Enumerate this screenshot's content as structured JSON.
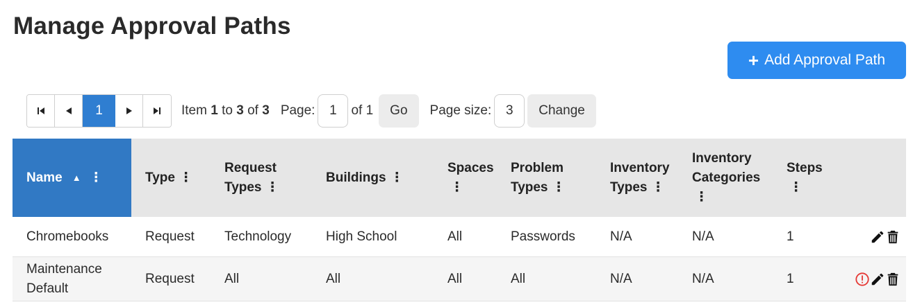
{
  "page": {
    "title": "Manage Approval Paths"
  },
  "add_button": {
    "plus": "+",
    "label": "Add Approval Path"
  },
  "pager": {
    "current_page": "1",
    "item_prefix": "Item",
    "item_from": "1",
    "item_to_word": "to",
    "item_to": "3",
    "item_of_word": "of",
    "item_total": "3",
    "page_label": "Page:",
    "page_value": "1",
    "page_of": "of 1",
    "go_label": "Go",
    "size_label": "Page size:",
    "size_value": "3",
    "change_label": "Change"
  },
  "columns": {
    "name": "Name",
    "type": "Type",
    "request_types_1": "Request",
    "request_types_2": "Types",
    "buildings": "Buildings",
    "spaces": "Spaces",
    "problem_types_1": "Problem",
    "problem_types_2": "Types",
    "inventory_types_1": "Inventory",
    "inventory_types_2": "Types",
    "inventory_categories_1": "Inventory",
    "inventory_categories_2": "Categories",
    "steps": "Steps",
    "sort_indicator": "▲",
    "menu_glyph": "⋮"
  },
  "rows": [
    {
      "name": "Chromebooks",
      "type": "Request",
      "request_types": "Technology",
      "buildings": "High School",
      "spaces": "All",
      "problem_types": "Passwords",
      "inventory_types": "N/A",
      "inventory_categories": "N/A",
      "steps": "1"
    },
    {
      "name_1": "Maintenance",
      "name_2": "Default",
      "type": "Request",
      "request_types": "All",
      "buildings": "All",
      "spaces": "All",
      "problem_types": "All",
      "inventory_types": "N/A",
      "inventory_categories": "N/A",
      "steps": "1"
    }
  ],
  "icons": {
    "pager_first": "first-page-icon",
    "pager_prev": "prev-page-icon",
    "pager_next": "next-page-icon",
    "pager_last": "last-page-icon",
    "edit": "pencil-icon",
    "delete": "trash-icon",
    "warning": "exclamation-circle-icon"
  },
  "colors": {
    "primary_button": "#2e8cf0",
    "active_page": "#2f7ed1",
    "sorted_header": "#3179c4",
    "header_bg": "#e6e6e6",
    "warning": "#e53935"
  }
}
